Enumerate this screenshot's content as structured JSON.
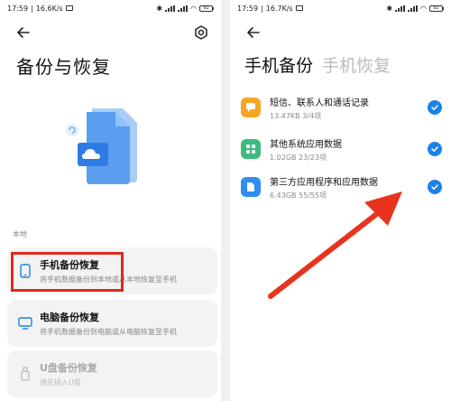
{
  "left": {
    "status": {
      "time": "17:59",
      "speed": "16.6K/s",
      "battery": "92"
    },
    "title": "备份与恢复",
    "section_label": "本地",
    "cards": [
      {
        "title": "手机备份恢复",
        "subtitle": "将手机数据备份到本地或从本地恢复至手机"
      },
      {
        "title": "电脑备份恢复",
        "subtitle": "将手机数据备份到电脑或从电脑恢复至手机"
      },
      {
        "title": "U盘备份恢复",
        "subtitle": "请先插入U盘"
      }
    ]
  },
  "right": {
    "status": {
      "time": "17:59",
      "speed": "16.7K/s",
      "battery": "92"
    },
    "tabs": {
      "active": "手机备份",
      "inactive": "手机恢复"
    },
    "items": [
      {
        "name": "短信、联系人和通话记录",
        "size": "13.47KB",
        "count": "3/4项",
        "checked": true
      },
      {
        "name": "其他系统应用数据",
        "size": "1.02GB",
        "count": "23/23项",
        "checked": true
      },
      {
        "name": "第三方应用程序和应用数据",
        "size": "6.43GB",
        "count": "55/55项",
        "checked": true
      }
    ]
  },
  "colors": {
    "accent": "#1a82e8",
    "highlight": "#e0281e",
    "arrow": "#e8341f"
  },
  "icons": {
    "back": "arrow-left-icon",
    "settings": "gear-icon",
    "phone": "phone-icon",
    "monitor": "monitor-icon",
    "usb": "usb-icon",
    "check": "check-icon"
  }
}
